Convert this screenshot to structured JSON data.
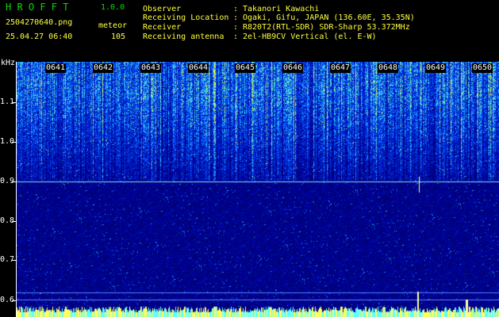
{
  "app": {
    "name": "H R O F F T",
    "version": "1.0.0"
  },
  "file": {
    "name": "2504270640.png",
    "datetime": "25.04.27 06:40"
  },
  "detection": {
    "label": "meteor",
    "count": "105"
  },
  "info": [
    {
      "key": "Observer",
      "sep": ":",
      "value": "Takanori Kawachi"
    },
    {
      "key": "Receiving Location",
      "sep": ":",
      "value": "Ogaki, Gifu, JAPAN (136.60E, 35.35N)"
    },
    {
      "key": "Receiver",
      "sep": ":",
      "value": "R820T2(RTL-SDR) SDR-Sharp 53.372MHz"
    },
    {
      "key": "Receiving antenna",
      "sep": ":",
      "value": "2el-HB9CV Vertical (el. E-W)"
    }
  ],
  "spectrogram": {
    "y_unit": "kHz",
    "x_ticks": [
      "0641",
      "0642",
      "0643",
      "0644",
      "0645",
      "0646",
      "0647",
      "0648",
      "0649",
      "0650"
    ],
    "y_ticks": [
      "1.1",
      "1.0",
      "0.9",
      "0.8",
      "0.7",
      "0.6"
    ],
    "colors": {
      "background": "#000000",
      "text": "#ffffff",
      "accent": "#ffff40",
      "title": "#00e000",
      "carrier": "#7fe0ff"
    }
  }
}
